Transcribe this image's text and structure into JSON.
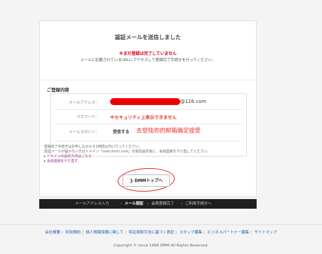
{
  "page": {
    "title": "認証メールを送信しました",
    "warning": "※まだ登録は完了していません",
    "subtitle": "メールに記載されているURLにアクセスして登録完了手続きを行ってください。"
  },
  "registration": {
    "section_title": "ご登録内容",
    "email_label": "メールアドレス：",
    "email_value": "@126.com",
    "password_label": "パスワード：",
    "password_value": "※セキュリティ上表示できません",
    "magazine_label": "メールマガジン：",
    "magazine_value": "受信する",
    "annotation": "去登陆你的邮箱确定接受"
  },
  "help": {
    "line1": "登録完了手続きはお申し込みから1時間以内に行ってください。",
    "line2": "認証メールが届かない方はドメイン「mail.dmm.com」の受信設定後に、会員登録をやり直してください。",
    "domain_link": "ドメインの設定方法はこちら",
    "redo_link": "会員登録をやり直す"
  },
  "button": {
    "label": "DMMトップへ"
  },
  "steps": [
    {
      "label": "メールアドレス入力",
      "active": false
    },
    {
      "label": "メール認証",
      "active": true
    },
    {
      "label": "会員登録完了",
      "active": false
    },
    {
      "label": "ご利用手続きへ",
      "active": false
    }
  ],
  "footer": {
    "links": [
      "会社概要",
      "利用規約",
      "個人情報保護に関して",
      "特定商取引法に基づく表記",
      "スタッフ募集",
      "ビジネスパートナー募集",
      "サイトマップ"
    ],
    "copyright": "Copyright © since 1998 DMM All Rights Reserved."
  },
  "colors": {
    "warning": "#d0021b",
    "link": "#1d5fb1",
    "redact": "#ee0000",
    "steps_bg": "#1f1f1f"
  }
}
